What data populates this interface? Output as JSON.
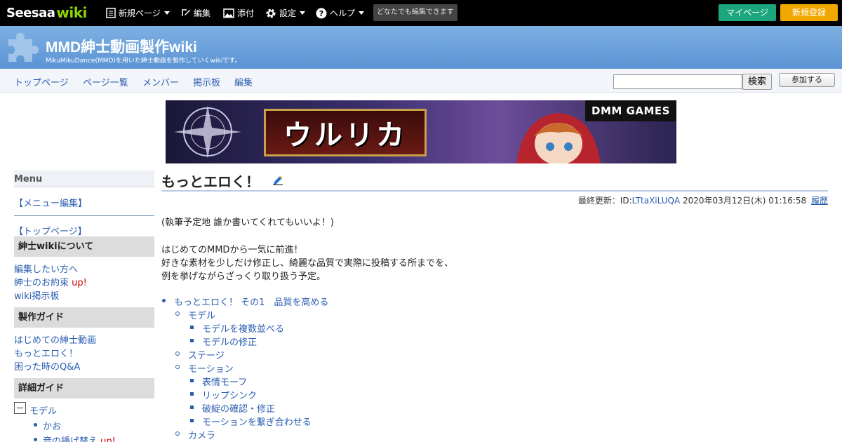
{
  "topbar": {
    "brand": "Seesaa",
    "brand_suffix": "wiki",
    "menu": {
      "new_page": "新規ページ",
      "edit": "編集",
      "attach": "添付",
      "settings": "設定",
      "help": "ヘルプ"
    },
    "anyone_can_edit": "どなたでも編集できます",
    "mypage": "マイページ",
    "register": "新規登録"
  },
  "header": {
    "title": "MMD紳士動画製作wiki",
    "subtitle": "MikuMikuDance(MMD)を用いた紳士動画を製作していくwikiです。"
  },
  "nav": {
    "items": [
      "トップページ",
      "ページ一覧",
      "メンバー",
      "掲示板",
      "編集"
    ],
    "search_value": "",
    "search_button": "検索",
    "join_button": "参加する"
  },
  "banner": {
    "title": "ウルリカ",
    "brand": "DMM GAMES"
  },
  "sidebar": {
    "menu_label": "Menu",
    "menu_edit": "【メニュー編集】",
    "top_page": "【トップページ】",
    "section1": "紳士wikiについて",
    "section1_links": [
      "編集したい方へ",
      "紳士のお約束",
      "wiki掲示板"
    ],
    "up_label": "up!",
    "section2": "製作ガイド",
    "section2_links": [
      "はじめての紳士動画",
      "もっとエロく！",
      "困った時のQ&A"
    ],
    "section3": "詳細ガイド",
    "tree_model": "モデル",
    "tree_children": [
      "かお",
      "音の挿げ替え"
    ]
  },
  "main": {
    "title": "もっとエロく！",
    "meta_prefix": "最終更新：",
    "meta_id_label": "ID:",
    "meta_id": "LTtaXiLUQA",
    "meta_date": "2020年03月12日(木) 01:16:58",
    "meta_history": "履歴",
    "note": "(執筆予定地 誰か書いてくれてもいいよ！)",
    "para": [
      "はじめてのMMDから一気に前進！",
      "好きな素材を少しだけ修正し、綺麗な品質で実際に投稿する所までを、",
      "例を挙げながらざっくり取り扱う予定。"
    ],
    "toc": {
      "l1": "もっとエロく！ その1　品質を高める",
      "model": "モデル",
      "model_children": [
        "モデルを複数並べる",
        "モデルの修正"
      ],
      "stage": "ステージ",
      "motion": "モーション",
      "motion_children": [
        "表情モーフ",
        "リップシンク",
        "破綻の確認・修正",
        "モーションを繋ぎ合わせる"
      ],
      "camera": "カメラ"
    }
  }
}
